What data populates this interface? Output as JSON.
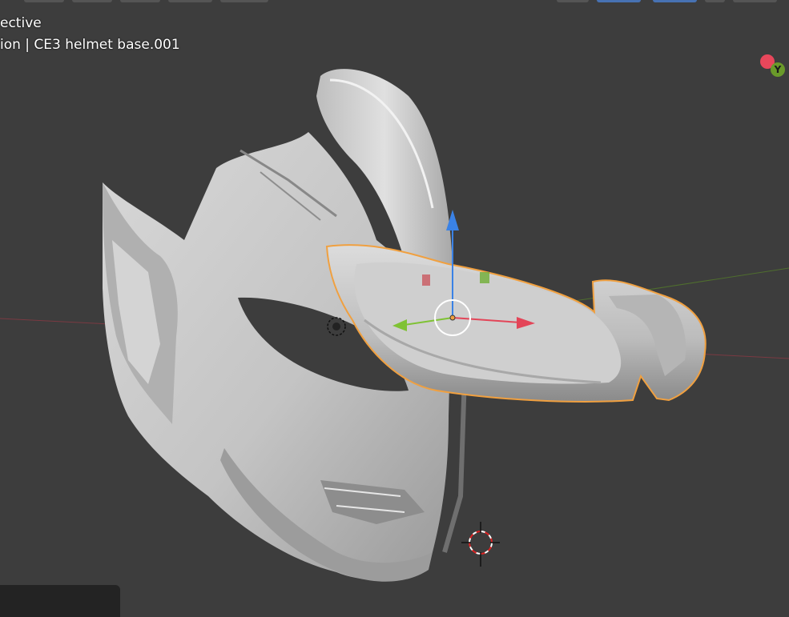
{
  "viewport": {
    "view_mode": "ective",
    "object_info": "ion | CE3 helmet base.001",
    "background_color": "#3d3d3d"
  },
  "nav_gizmo": {
    "y_label": "Y",
    "x_color": "#e8475b",
    "y_color": "#6a9a2a"
  },
  "colors": {
    "selection_outline": "#f0a040",
    "mesh": "#c8c8c8",
    "x_axis": "#e34558",
    "y_axis": "#7fc234",
    "z_axis": "#3a82e6"
  },
  "icons": {
    "transform_gizmo": "move-gizmo-icon",
    "cursor": "3d-cursor-icon",
    "light": "light-icon"
  }
}
